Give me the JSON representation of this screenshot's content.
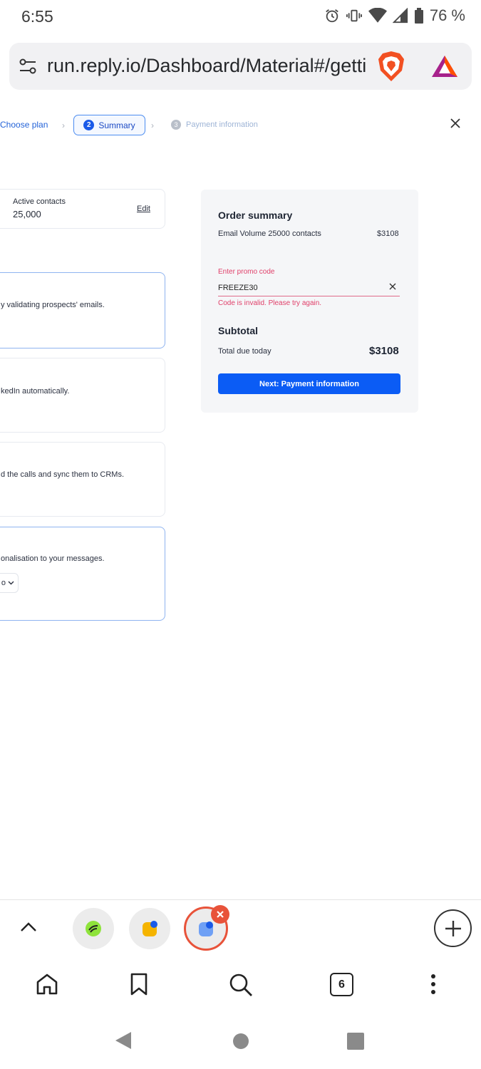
{
  "status_bar": {
    "time": "6:55",
    "battery_text": "76 %",
    "icons": [
      "alarm-icon",
      "vibrate-icon",
      "wifi-icon",
      "signal-icon",
      "battery-icon"
    ]
  },
  "browser": {
    "url": "run.reply.io/Dashboard/Material#/getti",
    "tab_count": "6"
  },
  "stepper": {
    "step1_label": "Choose plan",
    "step2_num": "2",
    "step2_label": "Summary",
    "step3_num": "3",
    "step3_label": "Payment information"
  },
  "left_cards": {
    "contacts_label": "Active contacts",
    "contacts_value": "25,000",
    "edit_label": "Edit",
    "card1_text": "y validating prospects' emails.",
    "card2_text": "kedIn automatically.",
    "card3_text": "d the calls and sync them to CRMs.",
    "card4_text": "onalisation to your messages.",
    "card4_select": "o"
  },
  "order_summary": {
    "title": "Order summary",
    "item_label": "Email Volume 25000 contacts",
    "item_price": "$3108",
    "promo_label": "Enter promo code",
    "promo_value": "FREEZE30",
    "promo_error": "Code is invalid. Please try again.",
    "subtotal_title": "Subtotal",
    "due_label": "Total due today",
    "due_value": "$3108",
    "next_button": "Next: Payment information"
  },
  "colors": {
    "accent": "#0b5cf5",
    "error": "#e0406a",
    "brave_orange": "#e8533a"
  }
}
